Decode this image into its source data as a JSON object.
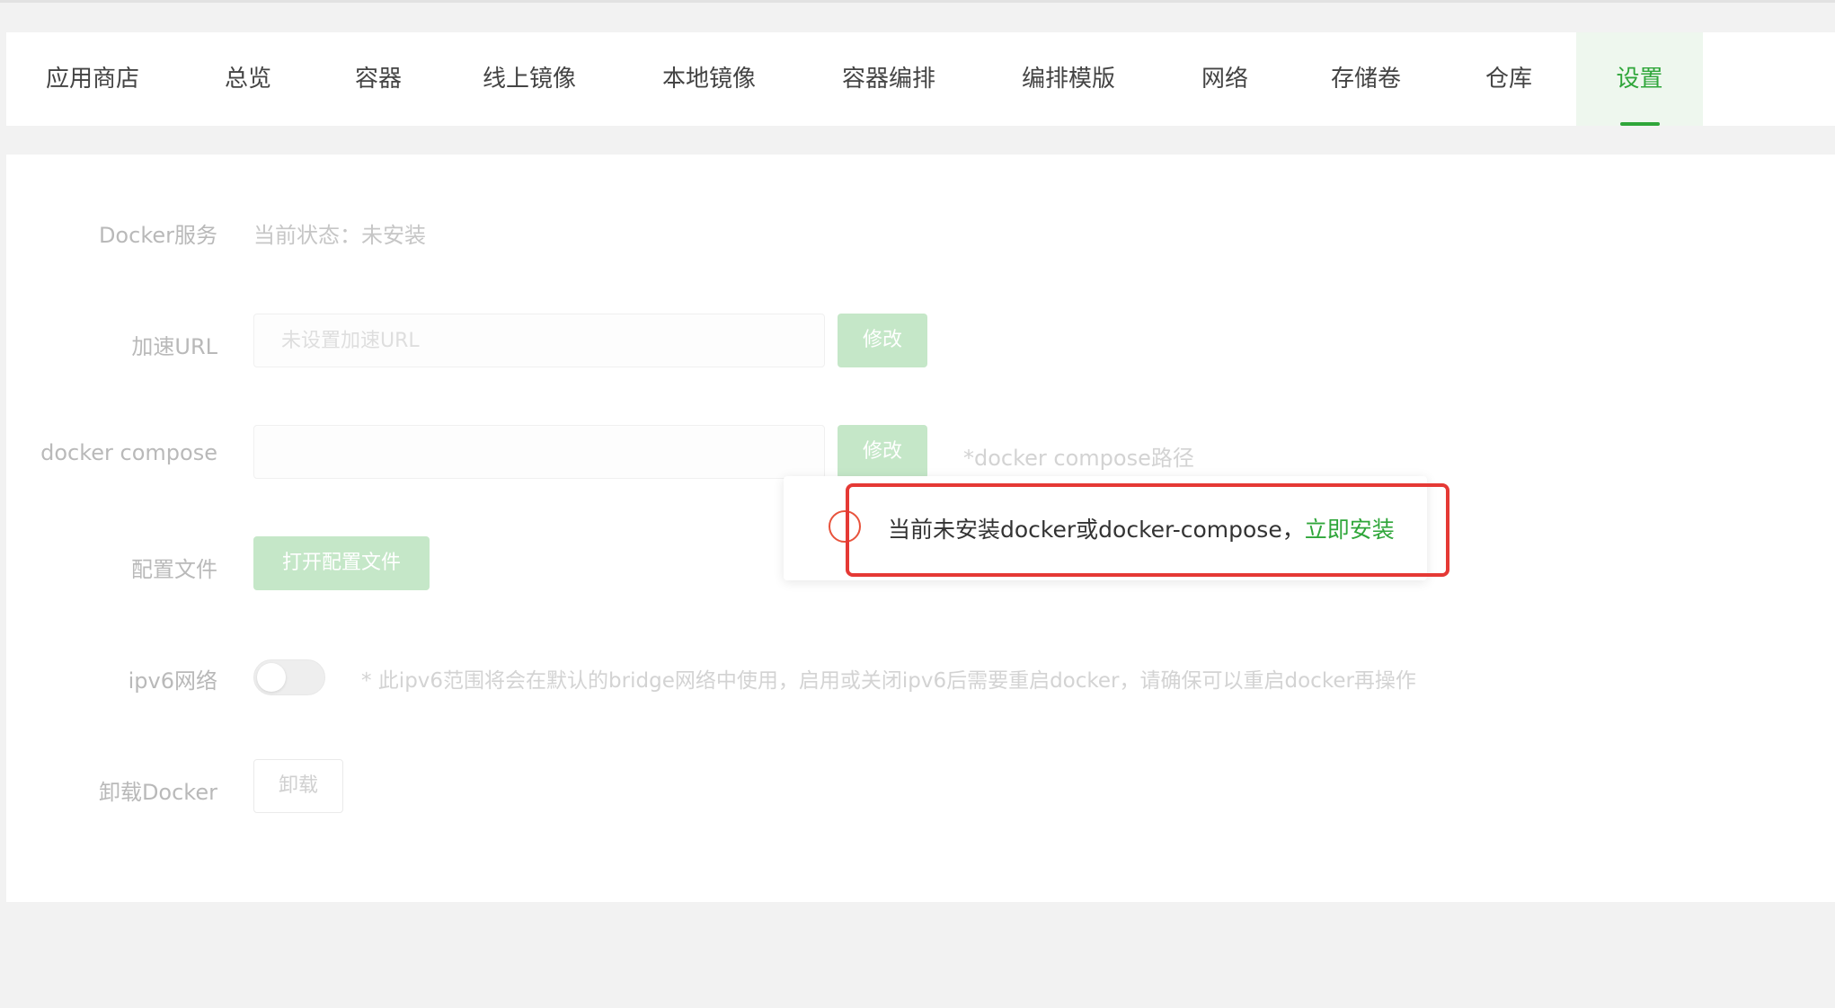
{
  "tabs": [
    {
      "label": "应用商店"
    },
    {
      "label": "总览"
    },
    {
      "label": "容器"
    },
    {
      "label": "线上镜像"
    },
    {
      "label": "本地镜像"
    },
    {
      "label": "容器编排"
    },
    {
      "label": "编排模版"
    },
    {
      "label": "网络"
    },
    {
      "label": "存储卷"
    },
    {
      "label": "仓库"
    },
    {
      "label": "设置",
      "active": true
    }
  ],
  "settings": {
    "docker_service": {
      "label": "Docker服务",
      "status": "当前状态：未安装"
    },
    "mirror_url": {
      "label": "加速URL",
      "placeholder": "未设置加速URL",
      "button": "修改"
    },
    "docker_compose": {
      "label": "docker compose",
      "value": "",
      "button": "修改",
      "hint": "*docker compose路径"
    },
    "config_file": {
      "label": "配置文件",
      "button": "打开配置文件"
    },
    "ipv6": {
      "label": "ipv6网络",
      "enabled": false,
      "hint": "* 此ipv6范围将会在默认的bridge网络中使用，启用或关闭ipv6后需要重启docker，请确保可以重启docker再操作"
    },
    "uninstall": {
      "label": "卸载Docker",
      "button": "卸载"
    }
  },
  "alert": {
    "message": "当前未安装docker或docker-compose，",
    "link": "立即安装",
    "icon": "warning-circle-icon"
  },
  "colors": {
    "accent": "#2fa63a",
    "warning": "#e8533c",
    "highlight": "#e53935"
  }
}
